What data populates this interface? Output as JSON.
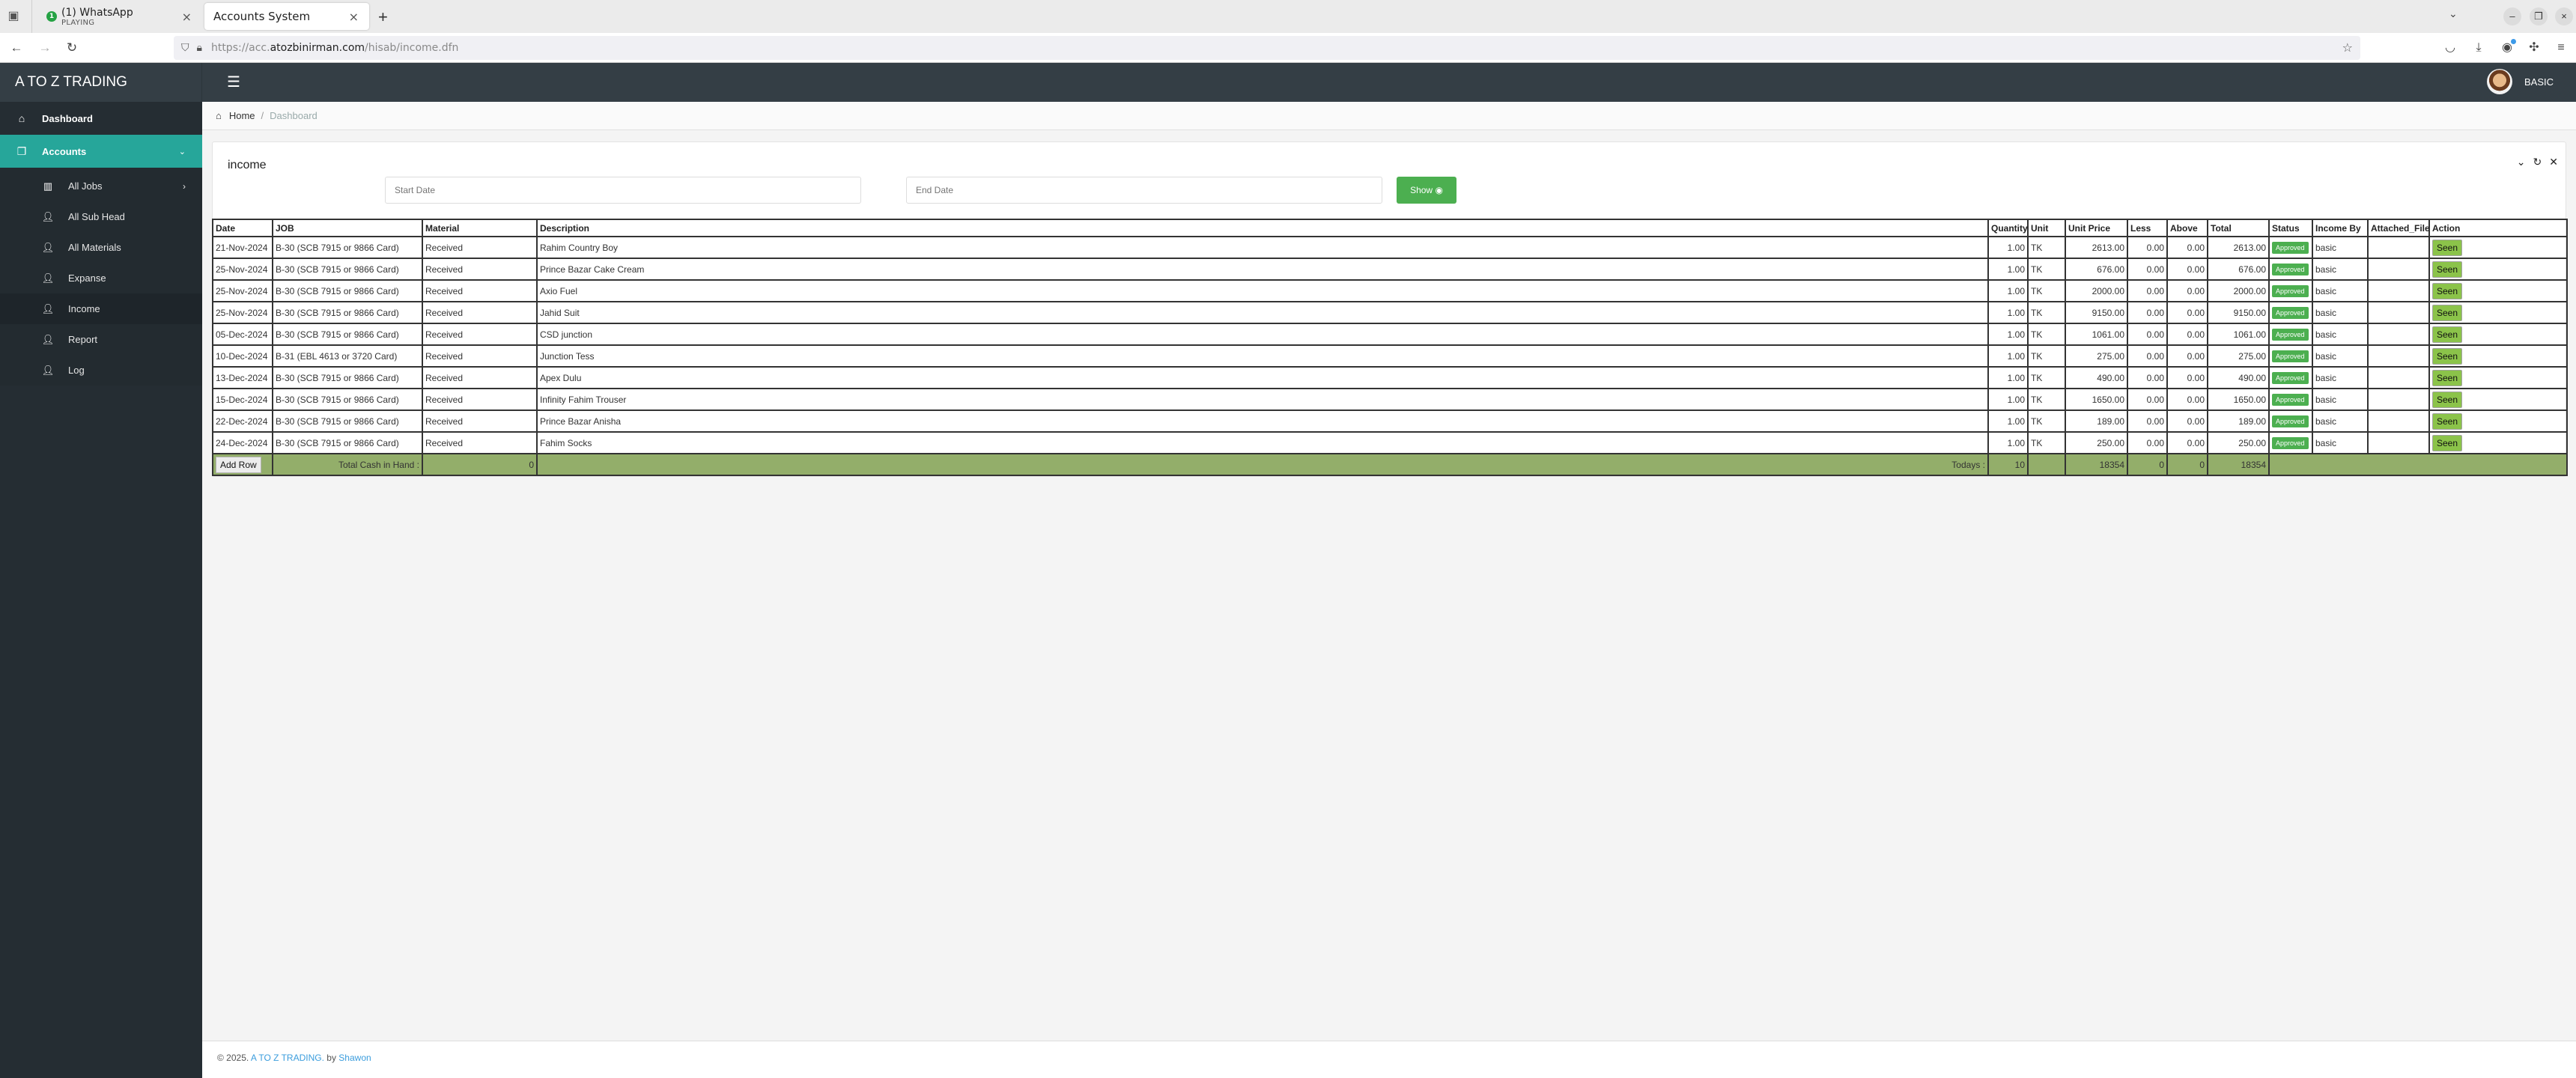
{
  "browser": {
    "tabs": [
      {
        "title": "(1) WhatsApp",
        "subtitle": "PLAYING",
        "badge": "1"
      },
      {
        "title": "Accounts System"
      }
    ],
    "url_prefix": "https://acc.",
    "url_domain": "atozbinirman.com",
    "url_path": "/hisab/income.dfn"
  },
  "header": {
    "brand": "A TO Z TRADING",
    "user_name": "BASIC"
  },
  "sidebar": {
    "items": [
      {
        "label": "Dashboard",
        "icon": "home-icon"
      },
      {
        "label": "Accounts",
        "icon": "copy-icon"
      }
    ],
    "sub_items": [
      {
        "label": "All Jobs",
        "icon": "notebook-icon"
      },
      {
        "label": "All Sub Head",
        "icon": "user-plus-icon"
      },
      {
        "label": "All Materials",
        "icon": "user-plus-icon"
      },
      {
        "label": "Expanse",
        "icon": "user-plus-icon"
      },
      {
        "label": "Income",
        "icon": "user-plus-icon"
      },
      {
        "label": "Report",
        "icon": "user-plus-icon"
      },
      {
        "label": "Log",
        "icon": "user-plus-icon"
      }
    ]
  },
  "breadcrumb": {
    "home": "Home",
    "current": "Dashboard"
  },
  "card": {
    "title": "income",
    "start_placeholder": "Start Date",
    "end_placeholder": "End Date",
    "show_label": "Show"
  },
  "table": {
    "columns": [
      "Date",
      "JOB",
      "Material",
      "Description",
      "Quantity",
      "Unit",
      "Unit Price",
      "Less",
      "Above",
      "Total",
      "Status",
      "Income By",
      "Attached_File",
      "Action"
    ],
    "rows": [
      {
        "date": "21-Nov-2024",
        "job": "B-30 (SCB 7915 or 9866 Card)",
        "material": "Received",
        "description": "Rahim Country Boy",
        "quantity": "1.00",
        "unit": "TK",
        "unit_price": "2613.00",
        "less": "0.00",
        "above": "0.00",
        "total": "2613.00",
        "status": "Approved",
        "income_by": "basic",
        "attached_file": "",
        "action": "Seen"
      },
      {
        "date": "25-Nov-2024",
        "job": "B-30 (SCB 7915 or 9866 Card)",
        "material": "Received",
        "description": "Prince Bazar Cake Cream",
        "quantity": "1.00",
        "unit": "TK",
        "unit_price": "676.00",
        "less": "0.00",
        "above": "0.00",
        "total": "676.00",
        "status": "Approved",
        "income_by": "basic",
        "attached_file": "",
        "action": "Seen"
      },
      {
        "date": "25-Nov-2024",
        "job": "B-30 (SCB 7915 or 9866 Card)",
        "material": "Received",
        "description": "Axio Fuel",
        "quantity": "1.00",
        "unit": "TK",
        "unit_price": "2000.00",
        "less": "0.00",
        "above": "0.00",
        "total": "2000.00",
        "status": "Approved",
        "income_by": "basic",
        "attached_file": "",
        "action": "Seen"
      },
      {
        "date": "25-Nov-2024",
        "job": "B-30 (SCB 7915 or 9866 Card)",
        "material": "Received",
        "description": "Jahid Suit",
        "quantity": "1.00",
        "unit": "TK",
        "unit_price": "9150.00",
        "less": "0.00",
        "above": "0.00",
        "total": "9150.00",
        "status": "Approved",
        "income_by": "basic",
        "attached_file": "",
        "action": "Seen"
      },
      {
        "date": "05-Dec-2024",
        "job": "B-30 (SCB 7915 or 9866 Card)",
        "material": "Received",
        "description": "CSD junction",
        "quantity": "1.00",
        "unit": "TK",
        "unit_price": "1061.00",
        "less": "0.00",
        "above": "0.00",
        "total": "1061.00",
        "status": "Approved",
        "income_by": "basic",
        "attached_file": "",
        "action": "Seen"
      },
      {
        "date": "10-Dec-2024",
        "job": "B-31 (EBL 4613 or 3720 Card)",
        "material": "Received",
        "description": "Junction Tess",
        "quantity": "1.00",
        "unit": "TK",
        "unit_price": "275.00",
        "less": "0.00",
        "above": "0.00",
        "total": "275.00",
        "status": "Approved",
        "income_by": "basic",
        "attached_file": "",
        "action": "Seen"
      },
      {
        "date": "13-Dec-2024",
        "job": "B-30 (SCB 7915 or 9866 Card)",
        "material": "Received",
        "description": "Apex Dulu",
        "quantity": "1.00",
        "unit": "TK",
        "unit_price": "490.00",
        "less": "0.00",
        "above": "0.00",
        "total": "490.00",
        "status": "Approved",
        "income_by": "basic",
        "attached_file": "",
        "action": "Seen"
      },
      {
        "date": "15-Dec-2024",
        "job": "B-30 (SCB 7915 or 9866 Card)",
        "material": "Received",
        "description": "Infinity Fahim Trouser",
        "quantity": "1.00",
        "unit": "TK",
        "unit_price": "1650.00",
        "less": "0.00",
        "above": "0.00",
        "total": "1650.00",
        "status": "Approved",
        "income_by": "basic",
        "attached_file": "",
        "action": "Seen"
      },
      {
        "date": "22-Dec-2024",
        "job": "B-30 (SCB 7915 or 9866 Card)",
        "material": "Received",
        "description": "Prince Bazar Anisha",
        "quantity": "1.00",
        "unit": "TK",
        "unit_price": "189.00",
        "less": "0.00",
        "above": "0.00",
        "total": "189.00",
        "status": "Approved",
        "income_by": "basic",
        "attached_file": "",
        "action": "Seen"
      },
      {
        "date": "24-Dec-2024",
        "job": "B-30 (SCB 7915 or 9866 Card)",
        "material": "Received",
        "description": "Fahim Socks",
        "quantity": "1.00",
        "unit": "TK",
        "unit_price": "250.00",
        "less": "0.00",
        "above": "0.00",
        "total": "250.00",
        "status": "Approved",
        "income_by": "basic",
        "attached_file": "",
        "action": "Seen"
      }
    ],
    "footer": {
      "add_row_label": "Add Row",
      "cash_label": "Total Cash in Hand :",
      "cash_value": "0",
      "todays_label": "Todays :",
      "quantity_total": "10",
      "unit_price_total": "18354",
      "less_total": "0",
      "above_total": "0",
      "grand_total": "18354"
    }
  },
  "footer": {
    "copyright": "© 2025.",
    "brand_link": "A TO Z TRADING.",
    "by": "by",
    "author_link": "Shawon"
  },
  "colors": {
    "sidebar_active": "#26a69a",
    "approved": "#4caf50",
    "seen": "#8bc34a",
    "table_footer": "#93ae6a",
    "header_bg": "#343e45"
  }
}
